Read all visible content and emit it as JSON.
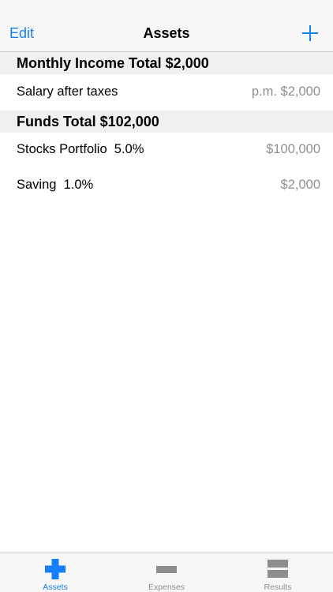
{
  "nav": {
    "edit_label": "Edit",
    "title": "Assets",
    "add_icon": "plus-icon"
  },
  "sections": [
    {
      "header": "Monthly Income Total $2,000",
      "rows": [
        {
          "label": "Salary after taxes",
          "value": "p.m. $2,000"
        }
      ]
    },
    {
      "header": "Funds Total $102,000",
      "rows": [
        {
          "label": "Stocks Portfolio  5.0%",
          "value": "$100,000"
        },
        {
          "label": "Saving  1.0%",
          "value": "$2,000"
        }
      ]
    }
  ],
  "tabbar": {
    "tabs": [
      {
        "label": "Assets",
        "icon": "plus-icon",
        "active": true
      },
      {
        "label": "Expenses",
        "icon": "minus-icon",
        "active": false
      },
      {
        "label": "Results",
        "icon": "equals-icon",
        "active": false
      }
    ]
  },
  "colors": {
    "accent": "#147efb",
    "secondary_text": "#8e8e93",
    "section_bg": "#f0f0f2",
    "inactive_icon": "#8e8e8e"
  }
}
